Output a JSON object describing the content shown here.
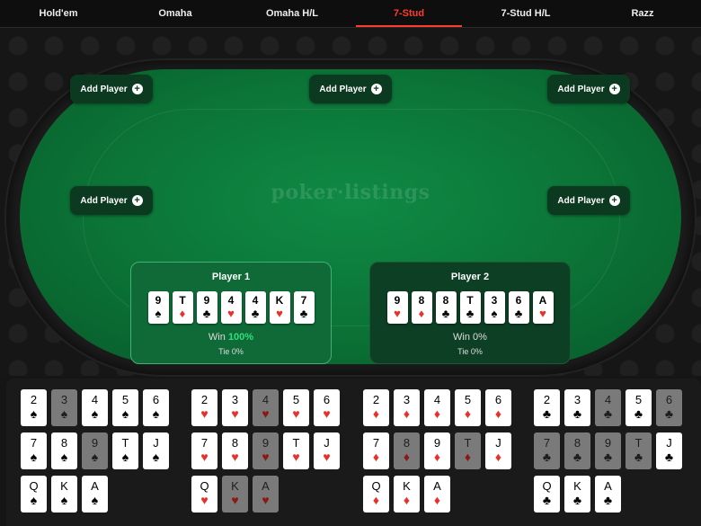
{
  "tabs": [
    {
      "label": "Hold'em",
      "active": false
    },
    {
      "label": "Omaha",
      "active": false
    },
    {
      "label": "Omaha H/L",
      "active": false
    },
    {
      "label": "7-Stud",
      "active": true
    },
    {
      "label": "7-Stud H/L",
      "active": false
    },
    {
      "label": "Razz",
      "active": false
    }
  ],
  "table": {
    "logo_text": "poker·listings",
    "add_player_label": "Add Player",
    "plus_glyph": "+"
  },
  "players": [
    {
      "name": "Player 1",
      "win_label": "Win",
      "win_pct": "100%",
      "tie_text": "Tie 0%",
      "cards": [
        {
          "rank": "9",
          "suit": "spades"
        },
        {
          "rank": "T",
          "suit": "diamonds"
        },
        {
          "rank": "9",
          "suit": "clubs"
        },
        {
          "rank": "4",
          "suit": "hearts"
        },
        {
          "rank": "4",
          "suit": "clubs"
        },
        {
          "rank": "K",
          "suit": "hearts"
        },
        {
          "rank": "7",
          "suit": "clubs"
        }
      ]
    },
    {
      "name": "Player 2",
      "win_label": "Win",
      "win_pct": "0%",
      "tie_text": "Tie 0%",
      "cards": [
        {
          "rank": "9",
          "suit": "hearts"
        },
        {
          "rank": "8",
          "suit": "diamonds"
        },
        {
          "rank": "8",
          "suit": "clubs"
        },
        {
          "rank": "T",
          "suit": "clubs"
        },
        {
          "rank": "3",
          "suit": "spades"
        },
        {
          "rank": "6",
          "suit": "clubs"
        },
        {
          "rank": "A",
          "suit": "hearts"
        }
      ]
    }
  ],
  "deck": {
    "suits": [
      "spades",
      "hearts",
      "diamonds",
      "clubs"
    ],
    "ranks": [
      "2",
      "3",
      "4",
      "5",
      "6",
      "7",
      "8",
      "9",
      "T",
      "J",
      "Q",
      "K",
      "A"
    ],
    "used": {
      "spades": [
        "3",
        "9"
      ],
      "hearts": [
        "4",
        "9",
        "K",
        "A"
      ],
      "diamonds": [
        "8",
        "T"
      ],
      "clubs": [
        "4",
        "6",
        "7",
        "8",
        "9",
        "T"
      ]
    }
  },
  "suit_glyphs": {
    "spades": "♠",
    "hearts": "♥",
    "diamonds": "♦",
    "clubs": "♣"
  },
  "colors": {
    "active_tab": "#ff3b30",
    "felt": "#0b7336",
    "win_highlight": "#2ee07a",
    "red_suit": "#e8312b"
  }
}
